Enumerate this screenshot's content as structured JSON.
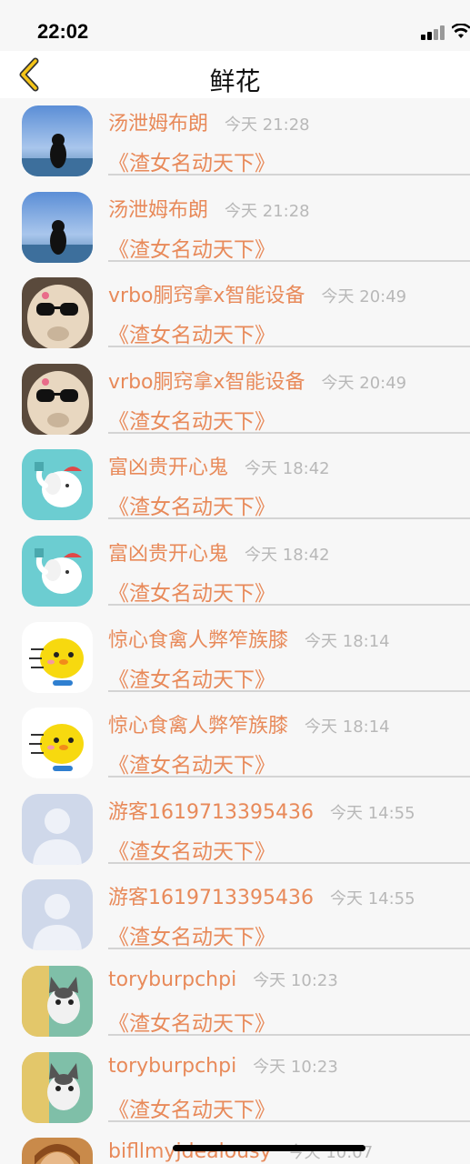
{
  "status_bar": {
    "time": "22:02"
  },
  "nav": {
    "title": "鲜花"
  },
  "rows": [
    {
      "name": "汤泄姆布朗",
      "time": "今天 21:28",
      "message": "《渣女名动天下》",
      "avatar": "sky-person"
    },
    {
      "name": "汤泄姆布朗",
      "time": "今天 21:28",
      "message": "《渣女名动天下》",
      "avatar": "sky-person"
    },
    {
      "name": "vrbo胴窍拿x智能设备",
      "time": "今天 20:49",
      "message": "《渣女名动天下》",
      "avatar": "alpaca"
    },
    {
      "name": "vrbo胴窍拿x智能设备",
      "time": "今天 20:49",
      "message": "《渣女名动天下》",
      "avatar": "alpaca"
    },
    {
      "name": "富凶贵开心鬼",
      "time": "今天 18:42",
      "message": "《渣女名动天下》",
      "avatar": "elephant"
    },
    {
      "name": "富凶贵开心鬼",
      "time": "今天 18:42",
      "message": "《渣女名动天下》",
      "avatar": "elephant"
    },
    {
      "name": "惊心食禽人弊笮族膝",
      "time": "今天 18:14",
      "message": "《渣女名动天下》",
      "avatar": "yellow-chick"
    },
    {
      "name": "惊心食禽人弊笮族膝",
      "time": "今天 18:14",
      "message": "《渣女名动天下》",
      "avatar": "yellow-chick"
    },
    {
      "name": "游客1619713395436",
      "time": "今天 14:55",
      "message": "《渣女名动天下》",
      "avatar": "default-user"
    },
    {
      "name": "游客1619713395436",
      "time": "今天 14:55",
      "message": "《渣女名动天下》",
      "avatar": "default-user"
    },
    {
      "name": "toryburpchpi",
      "time": "今天 10:23",
      "message": "《渣女名动天下》",
      "avatar": "cat"
    },
    {
      "name": "toryburpchpi",
      "time": "今天 10:23",
      "message": "《渣女名动天下》",
      "avatar": "cat"
    },
    {
      "name": "bifllmyjdealousy",
      "time": "今天 10:07",
      "message": "",
      "avatar": "portrait"
    }
  ]
}
